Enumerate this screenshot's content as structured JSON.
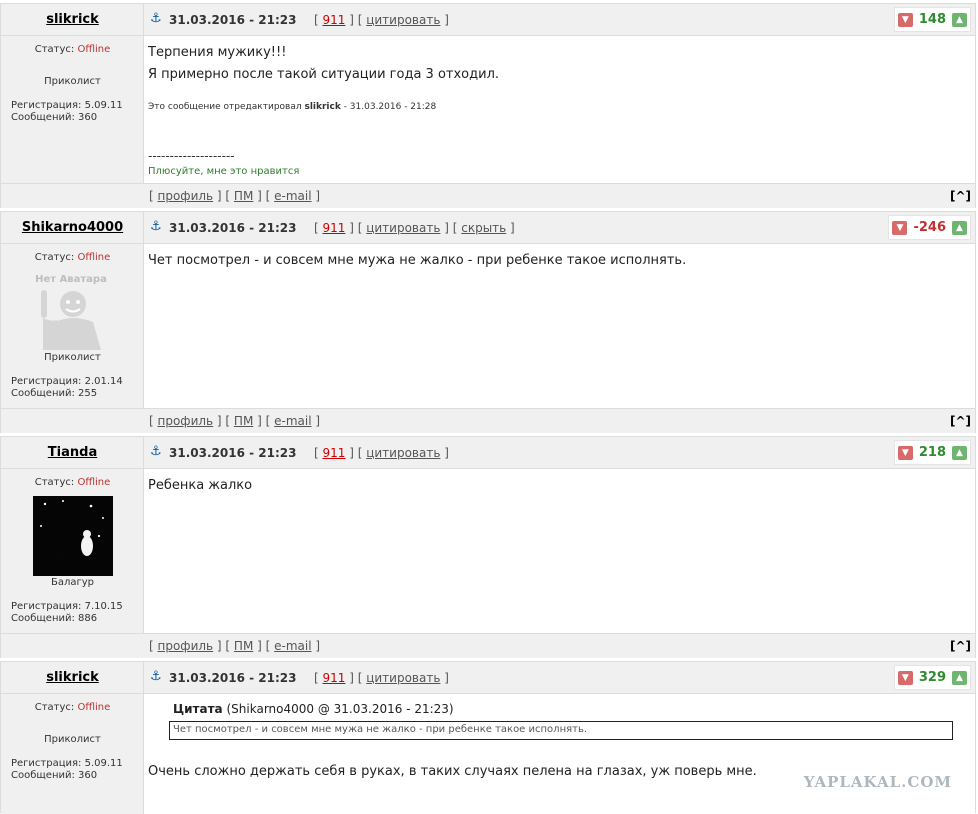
{
  "labels": {
    "status": "Статус: ",
    "registration": "Регистрация: ",
    "messages": "Сообщений: ",
    "quote_label": "Цитата",
    "profile": "профиль",
    "pm": "ПМ",
    "email": "e-mail",
    "to_top": "[^]",
    "quote": "цитировать",
    "hide": "скрыть",
    "edited_prefix": "Это сообщение отредактировал ",
    "no_avatar": "Нет Аватара"
  },
  "colors": {
    "positive": "#2e8b2e",
    "negative": "#c03030",
    "link_red": "#cc0000"
  },
  "posts": [
    {
      "username": "slikrick",
      "status": "Offline",
      "rank": "Приколист",
      "registered": "5.09.11",
      "messages": "360",
      "date": "31.03.2016 - 21:23",
      "post_number": "911",
      "score": "148",
      "lines": [
        "Терпения мужику!!!",
        "Я примерно после такой ситуации года 3 отходил."
      ],
      "edited_user": "slikrick",
      "edited_date": " - 31.03.2016 - 21:28",
      "signature_rule": "--------------------",
      "signature": "Плюсуйте, мне это нравится"
    },
    {
      "username": "Shikarno4000",
      "status": "Offline",
      "rank": "Приколист",
      "registered": "2.01.14",
      "messages": "255",
      "date": "31.03.2016 - 21:23",
      "post_number": "911",
      "score": "-246",
      "lines": [
        "Чет посмотрел - и совсем мне мужа не жалко - при ребенке такое исполнять."
      ]
    },
    {
      "username": "Tianda",
      "status": "Offline",
      "rank": "Балагур",
      "registered": "7.10.15",
      "messages": "886",
      "date": "31.03.2016 - 21:23",
      "post_number": "911",
      "score": "218",
      "lines": [
        "Ребенка жалко"
      ]
    },
    {
      "username": "slikrick",
      "status": "Offline",
      "rank": "Приколист",
      "registered": "5.09.11",
      "messages": "360",
      "date": "31.03.2016 - 21:23",
      "post_number": "911",
      "score": "329",
      "quote_meta": "(Shikarno4000 @ 31.03.2016 - 21:23)",
      "quote_text": "Чет посмотрел - и совсем мне мужа не жалко - при ребенке такое исполнять.",
      "lines": [
        "Очень сложно держать себя в руках, в таких случаях пелена на глазах, уж поверь мне."
      ]
    }
  ],
  "watermark": "YAPLAKAL.COM"
}
